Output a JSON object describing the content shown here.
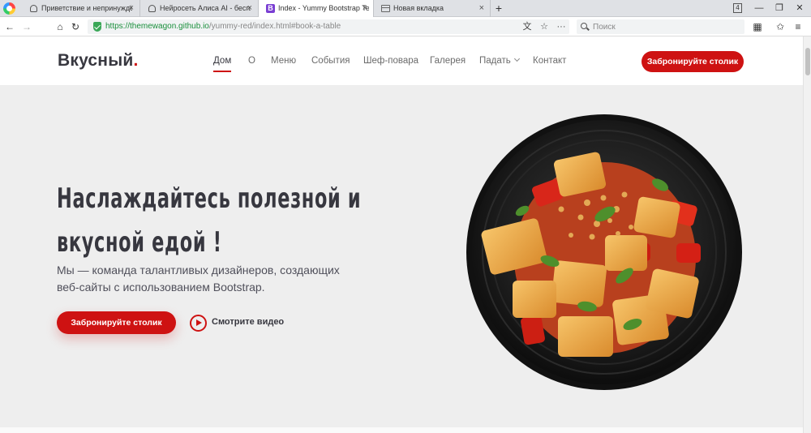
{
  "browser": {
    "tabs": [
      {
        "title": "Приветствие и непринуждё",
        "close": "×",
        "icon": "alice-icon"
      },
      {
        "title": "Нейросеть Алиса AI - беспл",
        "close": "×",
        "icon": "alice-icon"
      },
      {
        "title": "Index - Yummy Bootstrap Tem",
        "close": "×",
        "icon": "bootstrap-icon",
        "icon_text": "B"
      },
      {
        "title": "Новая вкладка",
        "close": "×",
        "icon": "newtab-icon"
      }
    ],
    "new_tab": "+",
    "tab_count": "4",
    "window_buttons": {
      "minimize": "—",
      "restore": "❐",
      "close": "✕"
    },
    "url": {
      "protocol_host": "https://themewagon.github.io",
      "path": "/yummy-red/index.html#book-a-table"
    },
    "search_placeholder": "Поиск",
    "icons": {
      "back": "←",
      "forward": "→",
      "home": "⌂",
      "reload": "↻",
      "translate": "文",
      "star": "☆",
      "more": "···",
      "extensions": "▦",
      "favorites": "✩",
      "menu": "≡"
    }
  },
  "site": {
    "logo": "Вкусный",
    "logo_dot": ".",
    "nav": [
      {
        "label": "Дом",
        "active": true
      },
      {
        "label": "О"
      },
      {
        "label": "Меню"
      },
      {
        "label": "События"
      },
      {
        "label": "Шеф-повара"
      },
      {
        "label": "Галерея"
      },
      {
        "label": "Падать",
        "dropdown": true
      },
      {
        "label": "Контакт"
      }
    ],
    "book_button": "Забронируйте столик",
    "accent_color": "#ce1212",
    "hero": {
      "title_line1": "Наслаждайтесь полезной и",
      "title_line2": "вкусной едой !",
      "subtitle": "Мы — команда талантливых дизайнеров, создающих веб-сайты с использованием Bootstrap.",
      "cta_button": "Забронируйте столик",
      "watch_video": "Смотрите видео",
      "image": "food-bowl-image"
    }
  }
}
